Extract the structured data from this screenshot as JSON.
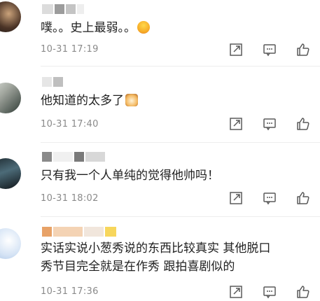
{
  "comments": [
    {
      "username_blocks": [
        "#dcdcdc",
        "#9c9c9c",
        "#c4c4c4",
        "#eeeeee"
      ],
      "text": "噗。。史上最弱。。",
      "emoji": "grinning-face-emoji",
      "time": "10-31 17:19"
    },
    {
      "username_blocks": [
        "#e6e6e6",
        "#bfbfbf"
      ],
      "text": "他知道的太多了",
      "emoji": "cat-face-emoji",
      "time": "10-31 17:40"
    },
    {
      "username_blocks": [
        "#8a8a8a",
        "#f0f0f0",
        "#7a7a7a",
        "#d8d8d8"
      ],
      "text": "只有我一个人单纯的觉得他帅吗！",
      "time": "10-31 18:02"
    },
    {
      "username_blocks": [
        "#e8a267",
        "#f4d3b4",
        "#f1e6dc",
        "#f7d65c"
      ],
      "text_lines": [
        "实话实说小葱秀说的东西比较真实  其他脱口",
        "秀节目完全就是在作秀  跟拍喜剧似的"
      ],
      "time": "10-31 17:36"
    }
  ],
  "icons": {
    "share": "share-icon",
    "reply": "reply-icon",
    "like": "thumbs-up-icon"
  },
  "colors": {
    "time": "#8a8a8a",
    "icon": "#5a5a5a",
    "divider": "#ededed"
  }
}
